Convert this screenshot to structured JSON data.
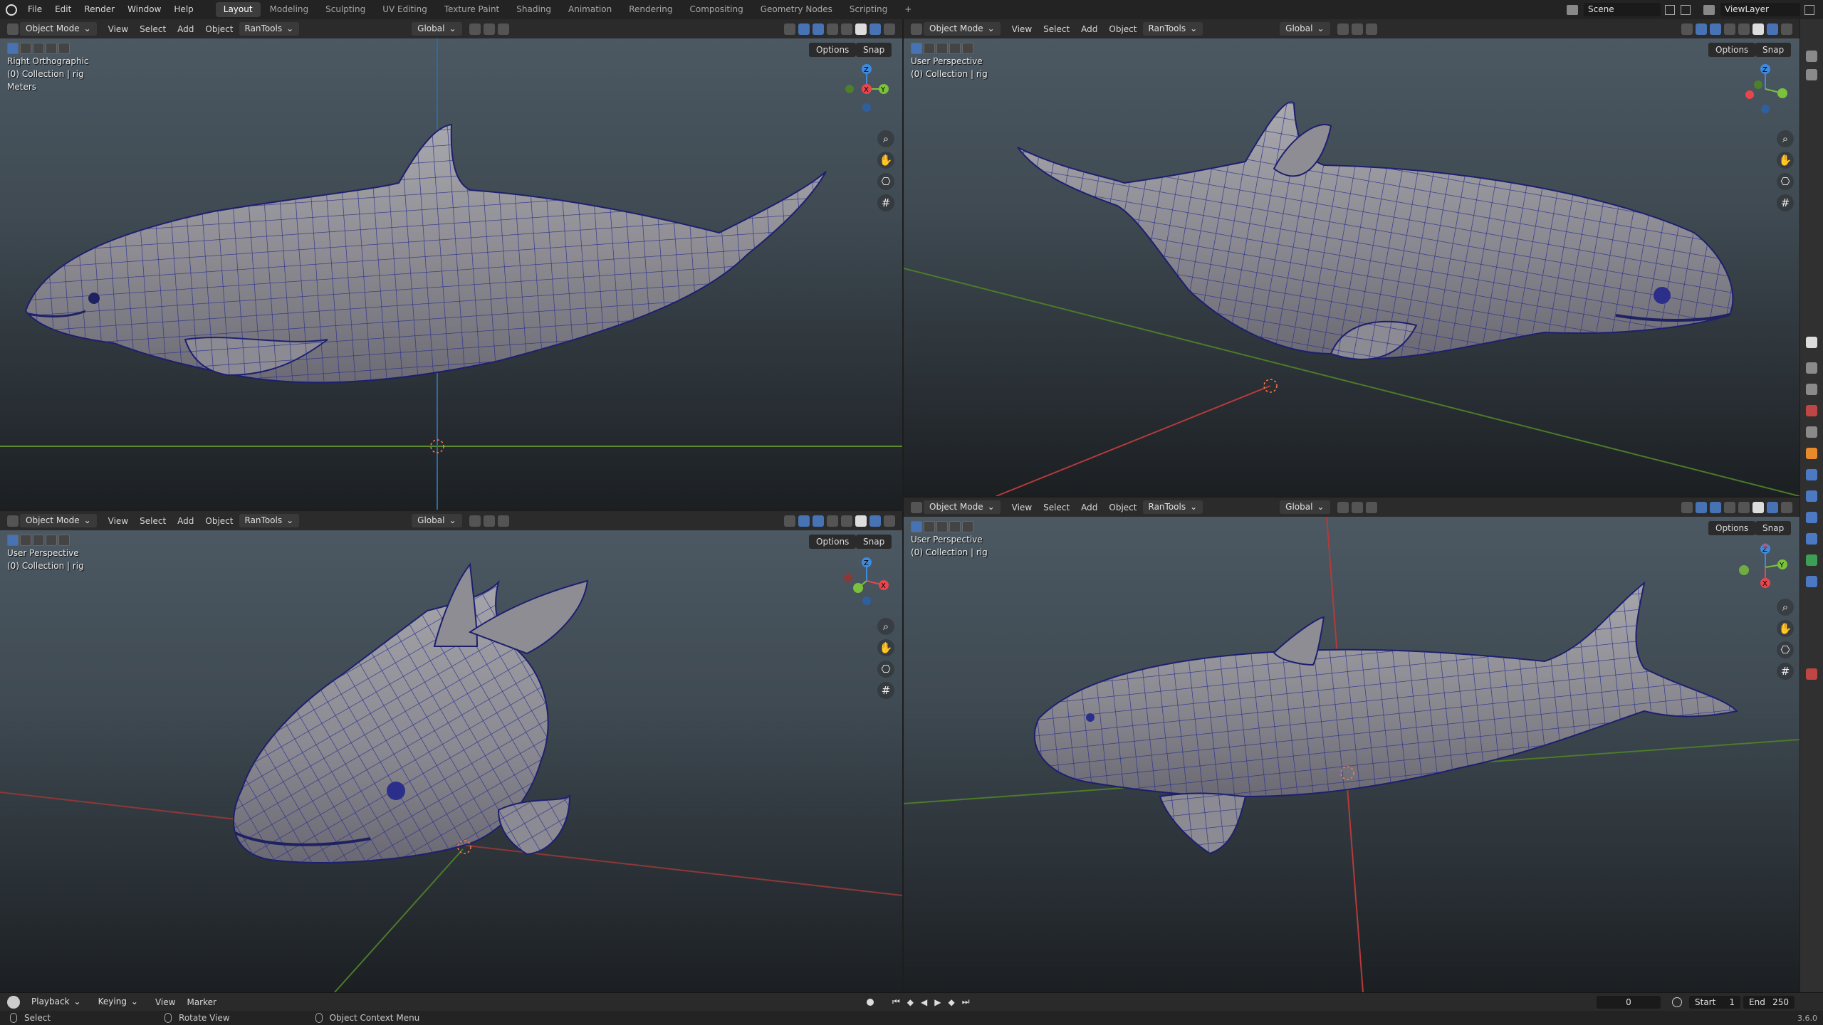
{
  "topbar": {
    "menus": [
      "File",
      "Edit",
      "Render",
      "Window",
      "Help"
    ],
    "workspaces": [
      "Layout",
      "Modeling",
      "Sculpting",
      "UV Editing",
      "Texture Paint",
      "Shading",
      "Animation",
      "Rendering",
      "Compositing",
      "Geometry Nodes",
      "Scripting"
    ],
    "active_workspace": "Layout",
    "add_tab": "+",
    "scene": "Scene",
    "view_layer": "ViewLayer"
  },
  "viewport_header": {
    "mode": "Object Mode",
    "view": "View",
    "select": "Select",
    "add": "Add",
    "object": "Object",
    "addon": "RanTools",
    "orientation": "Global",
    "options": "Options",
    "snap": "Snap"
  },
  "viewports": {
    "top_left": {
      "view_name": "Right Orthographic",
      "collection": "(0) Collection | rig",
      "units": "Meters"
    },
    "top_right": {
      "view_name": "User Perspective",
      "collection": "(0) Collection | rig"
    },
    "bottom_left": {
      "view_name": "User Perspective",
      "collection": "(0) Collection | rig"
    },
    "bottom_right": {
      "view_name": "User Perspective",
      "collection": "(0) Collection | rig"
    }
  },
  "gizmo_labels": {
    "x": "X",
    "y": "Y",
    "z": "Z"
  },
  "nav_icons": [
    "zoom-icon",
    "pan-hand-icon",
    "camera-icon",
    "grid-icon"
  ],
  "timeline": {
    "playback": "Playback",
    "keying": "Keying",
    "view": "View",
    "marker": "Marker",
    "current_frame": "0",
    "start_label": "Start",
    "start": "1",
    "end_label": "End",
    "end": "250"
  },
  "statusbar": {
    "select": "Select",
    "rotate": "Rotate View",
    "context": "Object Context Menu",
    "version": "3.6.0"
  },
  "colors": {
    "accent": "#4772b3",
    "axis_x": "#e8464d",
    "axis_y": "#7bc23c",
    "axis_z": "#3d8be0",
    "wire": "#2a2f8f"
  }
}
